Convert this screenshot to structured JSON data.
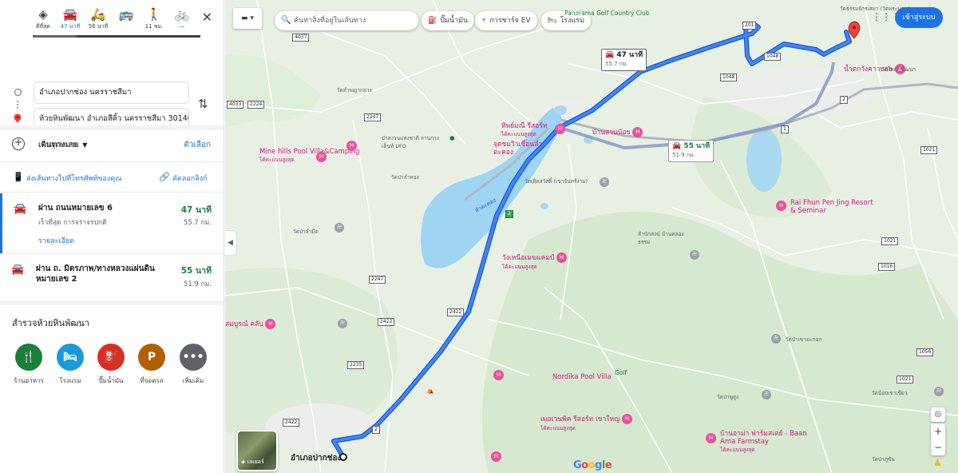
{
  "travel_modes": [
    {
      "icon": "diamond-directions-icon",
      "label": "ดีที่สุด",
      "glyph": "◈"
    },
    {
      "icon": "car-icon",
      "label": "47 นาที",
      "glyph": "🚘"
    },
    {
      "icon": "motorcycle-icon",
      "label": "56 นาที",
      "glyph": "🛵"
    },
    {
      "icon": "transit-icon",
      "label": "",
      "glyph": "🚌"
    },
    {
      "icon": "walk-icon",
      "label": "11 ชม.",
      "glyph": "🚶"
    },
    {
      "icon": "bicycle-icon",
      "label": "—",
      "glyph": "🚲"
    }
  ],
  "origin": "อำเภอปากช่อง นครราชสีมา",
  "destination": "ห้วยหินพัฒนา อำเภอสีคิ้ว นครราชสีมา 30140",
  "add_destination": "เพิ่มจุดหมาย",
  "leave_now": "เดินทางเลย",
  "options": "ตัวเลือก",
  "send_to_phone": "ส่งเส้นทางไปที่โทรศัพท์ของคุณ",
  "copy_link": "คัดลอกลิงก์",
  "routes": [
    {
      "via": "ผ่าน ถนนหมายเลข 6",
      "sub": "เร็วที่สุด การจราจรปกติ",
      "time": "47 นาที",
      "dist": "55.7 กม.",
      "details": "รายละเอียด"
    },
    {
      "via": "ผ่าน ถ. มิตรภาพ/ทางหลวงแผ่นดินหมายเลข 2",
      "sub": "",
      "time": "55 นาที",
      "dist": "51.9 กม.",
      "details": ""
    }
  ],
  "explore_title": "สำรวจห้วยหินพัฒนา",
  "categories": [
    {
      "label": "ร้านอาหาร",
      "icon": "restaurant-icon",
      "glyph": "🍴",
      "color": "#188038"
    },
    {
      "label": "โรงแรม",
      "icon": "hotel-icon",
      "glyph": "🛏",
      "color": "#1a9bd7"
    },
    {
      "label": "ปั๊มน้ำมัน",
      "icon": "gas-station-icon",
      "glyph": "⛽",
      "color": "#d93025"
    },
    {
      "label": "ที่จอดรถ",
      "icon": "parking-icon",
      "glyph": "P",
      "color": "#b06000"
    },
    {
      "label": "เพิ่มเติม",
      "icon": "more-icon",
      "glyph": "•••",
      "color": "#5f6368"
    }
  ],
  "map": {
    "search_placeholder": "ค้นหาสิ่งที่อยู่ในเส้นทาง",
    "chips": [
      {
        "label": "ปั๊มน้ำมัน",
        "icon": "gas-station-icon"
      },
      {
        "label": "การชาร์จ EV",
        "icon": "ev-charger-icon"
      },
      {
        "label": "โรงแรม",
        "icon": "hotel-icon"
      }
    ],
    "signin": "เข้าสู่ระบบ",
    "satellite_label": "เลเยอร์",
    "origin_label": "อำเภอปากช่อง",
    "bubble_main": {
      "time": "47 นาที",
      "dist": "55.7 กม."
    },
    "bubble_alt": {
      "time": "55 นาที",
      "dist": "51.9 กม."
    },
    "pois": [
      {
        "name": "Mine hills Pool Villa&Camping",
        "sub": "ได้คะแนนสูงสุด"
      },
      {
        "name": "ทิพย์มณี รีสอร์ท",
        "sub": "ได้คะแนนสูงสุด"
      },
      {
        "name": "จุดชมวิวเขื่อนลำตะคอง",
        "sub": ""
      },
      {
        "name": "บ้านสวนน้อย",
        "sub": ""
      },
      {
        "name": "วังเหนือเมฆแคมป์",
        "sub": "ได้คะแนนสูงสุด"
      },
      {
        "name": "Rai Fhun Pen Jing Resort & Seminar",
        "sub": ""
      },
      {
        "name": "Nordika Pool Villa",
        "sub": ""
      },
      {
        "name": "เมอเวนพิค รีสอร์ท เขาใหญ่",
        "sub": "ได้คะแนนสูงสุด"
      },
      {
        "name": "บ้านอาม่า ฟาร์มสเตย์ - Baan Ama Farmstay",
        "sub": "ได้คะแนนสูงสุด"
      },
      {
        "name": "น้ำตกวังคาวบอย",
        "sub": ""
      },
      {
        "name": "สมบูรณ์ คลับ",
        "sub": ""
      }
    ],
    "green_pois": [
      {
        "name": "Panorama Golf Country Club"
      },
      {
        "name": "Golf"
      }
    ],
    "places": [
      {
        "name": "วัดลำพญากลาง"
      },
      {
        "name": "ป่าสงวนแห่งชาติ ลานกางเต็นท์ UFO"
      },
      {
        "name": "วัดป่าลำทอง"
      },
      {
        "name": "วัดเทิดสวัสดิ์ (เขาจันทร์งาม)"
      },
      {
        "name": "สำนักสงฆ์ บ้านคลองธรรม"
      },
      {
        "name": "วัดป่าลำมีด"
      },
      {
        "name": "วัดป่าเขามะกอก"
      },
      {
        "name": "วัดป่าพูสูง"
      },
      {
        "name": "วัดน้อยเขาเขียว"
      },
      {
        "name": "วัดป่าภูซัน"
      },
      {
        "name": "วัดใหญ่สุพัฒนา"
      },
      {
        "name": "วัดธรรมจักรเสมา (วัดพระนอน)"
      },
      {
        "name": "ลำตะคอง"
      }
    ],
    "shields": [
      "4037",
      "2224",
      "2247",
      "4033",
      "2247",
      "2422",
      "2422",
      "2",
      "2",
      "2235",
      "2422",
      "1048",
      "1048",
      "1021",
      "1021",
      "1016",
      "1021",
      "1056",
      "201",
      "2",
      "1"
    ]
  }
}
